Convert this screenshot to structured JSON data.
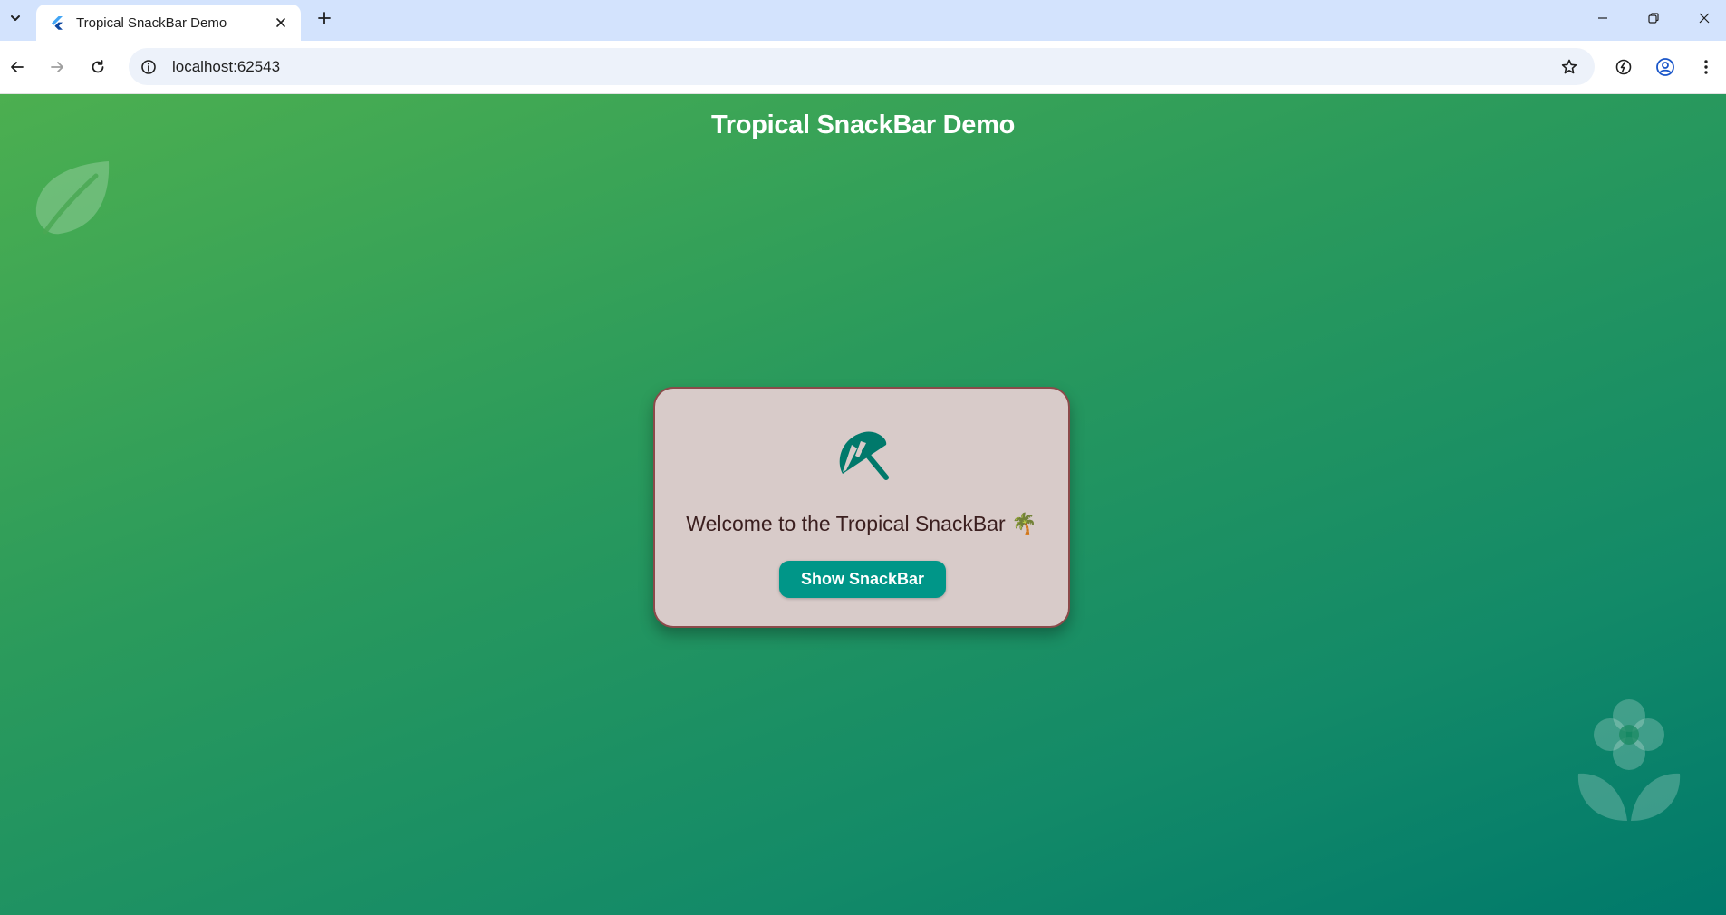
{
  "browser": {
    "tab": {
      "title": "Tropical SnackBar Demo",
      "favicon": "flutter-icon"
    },
    "address_bar": {
      "url": "localhost:62543"
    },
    "icons": {
      "tab_menu": "chevron-down-icon",
      "tab_close": "close-icon",
      "new_tab": "plus-icon",
      "minimize": "minimize-icon",
      "restore": "restore-icon",
      "close_window": "close-icon",
      "back": "arrow-left-icon",
      "forward": "arrow-right-icon",
      "reload": "reload-icon",
      "site_info": "info-icon",
      "bookmark": "star-icon",
      "performance": "speed-icon",
      "profile": "profile-icon",
      "menu": "more-vert-icon"
    }
  },
  "app": {
    "title": "Tropical SnackBar Demo",
    "background_colors": [
      "#4caf50",
      "#00796b"
    ],
    "decorations": [
      "leaf-icon",
      "flower-icon"
    ],
    "card": {
      "icon": "beach-umbrella-icon",
      "welcome_text": "Welcome to the Tropical SnackBar 🌴",
      "button_label": "Show SnackBar",
      "button_color": "#009688",
      "card_color": "#d8cbc9",
      "border_color": "#8b4a4a"
    }
  }
}
